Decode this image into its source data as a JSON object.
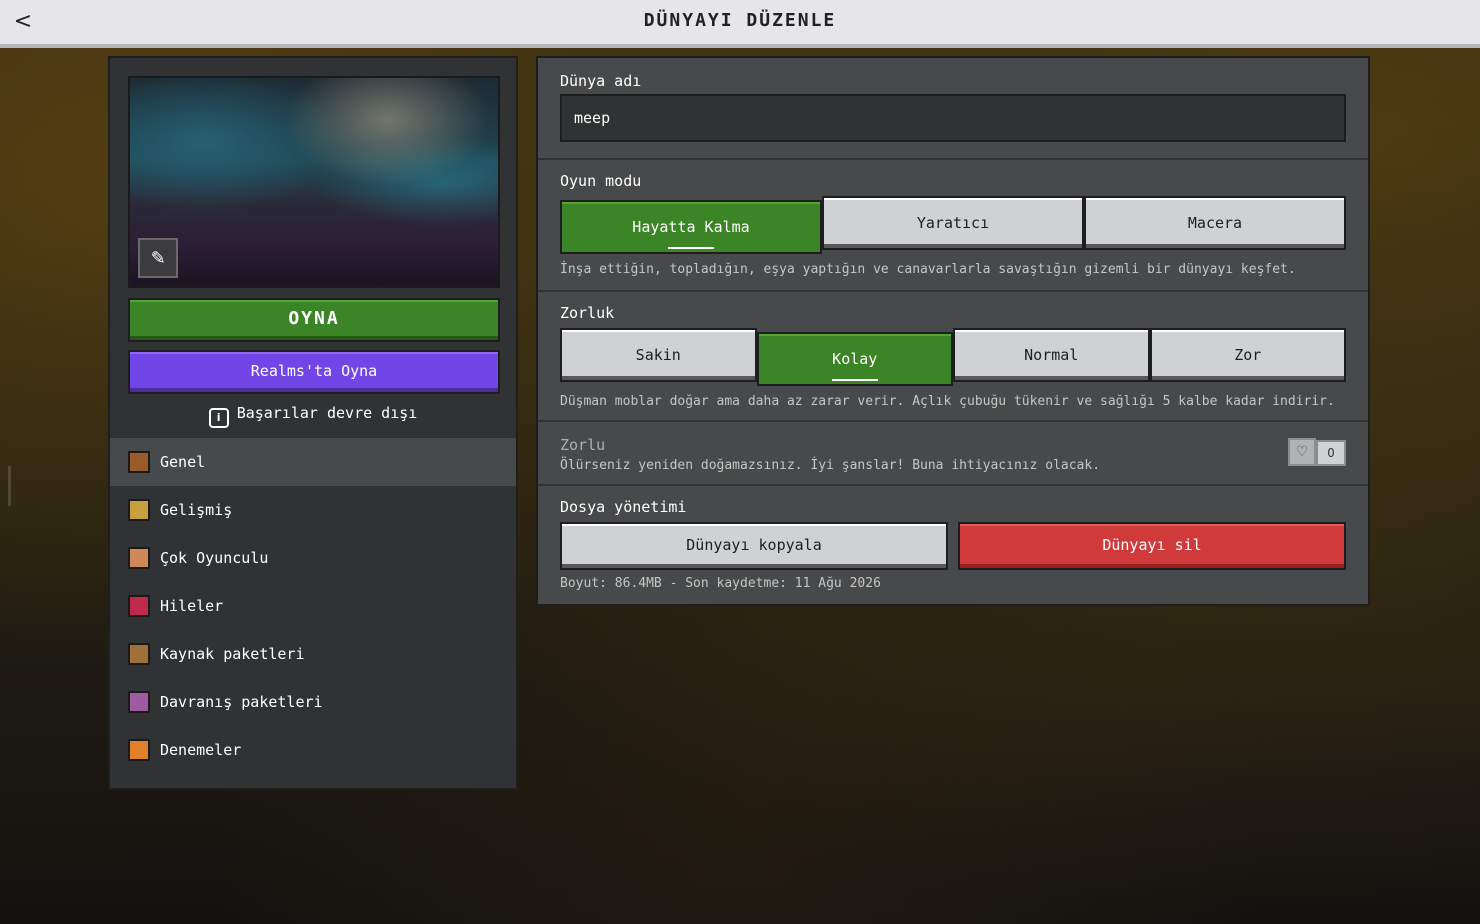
{
  "header": {
    "title": "DÜNYAYI DÜZENLE",
    "back_glyph": "<"
  },
  "left": {
    "play_label": "OYNA",
    "realms_label": "Realms'ta Oyna",
    "achievements_text": "Başarılar devre dışı",
    "info_glyph": "i",
    "nav": [
      {
        "label": "Genel",
        "icon": "gear-icon",
        "color": "#9a5a2a",
        "active": true
      },
      {
        "label": "Gelişmiş",
        "icon": "furnace-icon",
        "color": "#c8a040"
      },
      {
        "label": "Çok Oyunculu",
        "icon": "players-icon",
        "color": "#d08858"
      },
      {
        "label": "Hileler",
        "icon": "cheats-icon",
        "color": "#c02a4a"
      },
      {
        "label": "Kaynak paketleri",
        "icon": "resource-pack-icon",
        "color": "#a0703a"
      },
      {
        "label": "Davranış paketleri",
        "icon": "behavior-pack-icon",
        "color": "#a05aa0"
      },
      {
        "label": "Denemeler",
        "icon": "experiments-icon",
        "color": "#e0802a"
      }
    ]
  },
  "world_name": {
    "label": "Dünya adı",
    "value": "meep"
  },
  "game_mode": {
    "label": "Oyun modu",
    "options": [
      "Hayatta Kalma",
      "Yaratıcı",
      "Macera"
    ],
    "selected": "Hayatta Kalma",
    "description": "İnşa ettiğin, topladığın, eşya yaptığın ve canavarlarla savaştığın gizemli bir dünyayı keşfet."
  },
  "difficulty": {
    "label": "Zorluk",
    "options": [
      "Sakin",
      "Kolay",
      "Normal",
      "Zor"
    ],
    "selected": "Kolay",
    "description": "Düşman moblar doğar ama daha az zarar verir. Açlık çubuğu tükenir ve sağlığı 5 kalbe kadar indirir."
  },
  "hardcore": {
    "label": "Zorlu",
    "description": "Ölürseniz yeniden doğamazsınız. İyi şanslar! Buna ihtiyacınız olacak.",
    "toggle_state": "O",
    "enabled": false
  },
  "file_management": {
    "label": "Dosya yönetimi",
    "copy_label": "Dünyayı kopyala",
    "delete_label": "Dünyayı sil",
    "info": "Boyut: 86.4MB - Son kaydetme: 11 Ağu 2026"
  },
  "colors": {
    "accent_green": "#3c8527",
    "realms_purple": "#7245e6",
    "delete_red": "#d03a3a",
    "panel_dark": "#313233",
    "panel_mid": "#48494a"
  }
}
